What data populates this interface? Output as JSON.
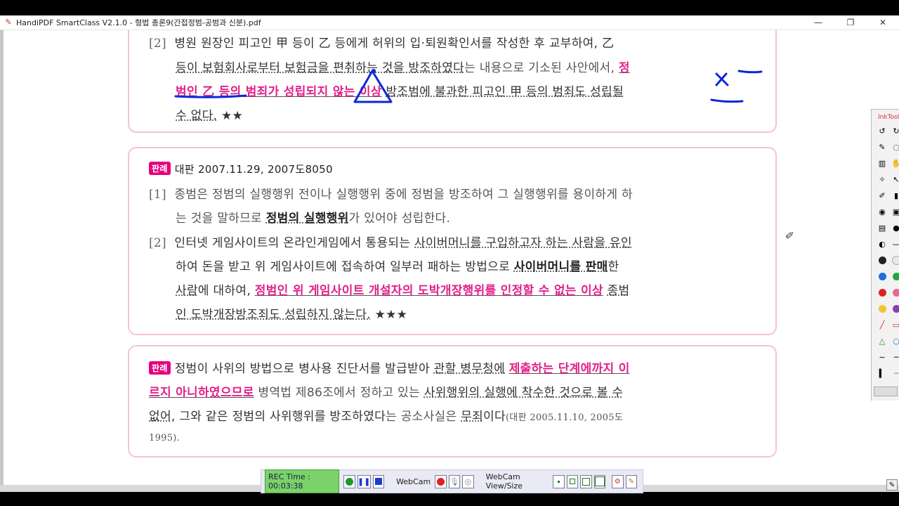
{
  "window": {
    "title": "HandiPDF SmartClass V2.1.0 - 형법 총론9(간접정범-공범과 신분).pdf",
    "minimize": "—",
    "maximize": "❐",
    "close": "✕"
  },
  "box1": {
    "l1_num": "[2]",
    "l1": "병원 원장인 피고인 甲 등이 乙 등에게 허위의 입·퇴원확인서를 작성한 후 교부하여, 乙",
    "l2a": "등이 보험회사로부터 보험금을 편취하는 것을 방조하였다",
    "l2b": "는 내용으로 기소된 사안에서,",
    "l2c": "정",
    "l3a": "범인 乙 등의 범죄가 성립되지 않는 이상",
    "l3b": "방조범에 불과한 피고인 甲 등의 범죄도 성립될",
    "l4": "수 없다.",
    "stars": "★★"
  },
  "box2": {
    "badge": "판례",
    "ref": "대판 2007.11.29, 2007도8050",
    "i1_num": "[1]",
    "i1_l1": "종범은 정범의 실행행위 전이나 실행행위 중에 정범을 방조하여 그 실행행위를 용이하게 하",
    "i1_l2a": "는 것을 말하므로",
    "i1_l2b": "정범의 실행행위",
    "i1_l2c": "가 있어야 성립한다.",
    "i2_num": "[2]",
    "i2_l1a": "인터넷 게임사이트의 온라인게임에서 통용되는",
    "i2_l1b": "사이버머니를 구입하고자 하는 사람을 유인",
    "i2_l2a": "하여 돈을 받고 위 게임사이트에 접속하여 일부러 패하는 방법으로",
    "i2_l2b": "사이버머니를 판매",
    "i2_l2c": "한",
    "i2_l3a": "사람",
    "i2_l3b": "에 대하여,",
    "i2_l3c": "정범인 위 게임사이트 개설자의 도박개장행위를 인정할 수 없는 이상",
    "i2_l3d": "종범",
    "i2_l4": "인 도박개장방조죄도 성립하지 않는다.",
    "stars": "★★★"
  },
  "box3": {
    "badge": "판례",
    "l1a": "정범이 사위의 방법으로 병사용 진단서를 발급받아",
    "l1b": "관할 병무청에",
    "l1c": "제출하는 단계에까지 이",
    "l2a": "르지 아니하였으므로",
    "l2b": "병역법 제86조에서 정하고 있는",
    "l2c": "사위행위의 실행에 착수한 것으로 볼 수",
    "l3a": "없어",
    "l3b": ", 그와 같은 정범의 사위행위를 방조하였다",
    "l3c": "는 공소사실은",
    "l3d": "무죄",
    "l3e": "이다",
    "l3f": "(대판 2005.11.10, 2005도",
    "l4": "1995)."
  },
  "inktool": {
    "title": "InkTool",
    "colors": [
      "#222222",
      "#e8e8e8",
      "#1e6fd8",
      "#1fa83a",
      "#e02020",
      "#e86a8a",
      "#f4c430",
      "#8a3fb0"
    ]
  },
  "recorder": {
    "rec_time": "REC Time : 00:03:38",
    "webcam_label": "WebCam",
    "webcam_view_label": "WebCam View/Size"
  },
  "colors": {
    "accent_pink": "#e0218a",
    "box_border": "#f4c4cc",
    "badge": "#e6007e",
    "annotation_blue": "#0a28d8"
  }
}
